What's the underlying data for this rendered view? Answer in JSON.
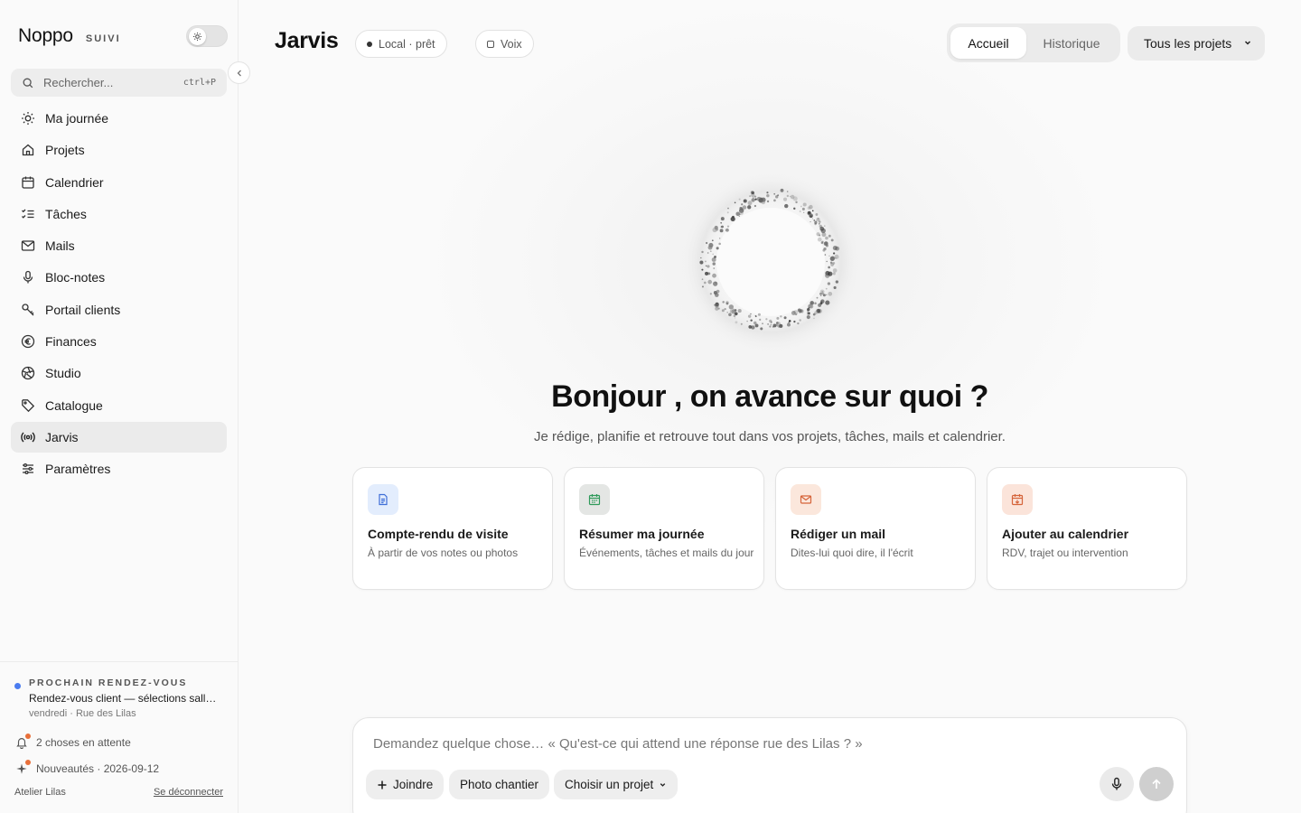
{
  "sidebar": {
    "brand": "Noppo",
    "brand_tag": "SUIVI",
    "theme_icon": "sun-icon",
    "search": {
      "placeholder": "Rechercher...",
      "shortcut": "ctrl+P"
    },
    "items": [
      {
        "label": "Ma journée",
        "icon": "sun-icon",
        "active": false
      },
      {
        "label": "Projets",
        "icon": "home-icon",
        "active": false
      },
      {
        "label": "Calendrier",
        "icon": "calendar-icon",
        "active": false
      },
      {
        "label": "Tâches",
        "icon": "checklist-icon",
        "active": false
      },
      {
        "label": "Mails",
        "icon": "mail-icon",
        "active": false
      },
      {
        "label": "Bloc-notes",
        "icon": "microphone-icon",
        "active": false
      },
      {
        "label": "Portail clients",
        "icon": "key-icon",
        "active": false
      },
      {
        "label": "Finances",
        "icon": "euro-icon",
        "active": false
      },
      {
        "label": "Studio",
        "icon": "aperture-icon",
        "active": false
      },
      {
        "label": "Catalogue",
        "icon": "tag-icon",
        "active": false
      },
      {
        "label": "Jarvis",
        "icon": "broadcast-icon",
        "active": true
      },
      {
        "label": "Paramètres",
        "icon": "sliders-icon",
        "active": false
      }
    ],
    "footer": {
      "next_label": "PROCHAIN RENDEZ-VOUS",
      "next_title": "Rendez-vous client — sélections sall…",
      "next_sub": "vendredi · Rue des Lilas",
      "pending": "2 choses en attente",
      "news": "Nouveautés · 2026-09-12",
      "workspace": "Atelier Lilas",
      "logout": "Se déconnecter",
      "accent": "#4a7cf0",
      "badge_color": "#e8703a"
    }
  },
  "header": {
    "title": "Jarvis",
    "status_pill": "Local · prêt",
    "voice_pill": "Voix",
    "tabs": [
      {
        "label": "Accueil",
        "active": true
      },
      {
        "label": "Historique",
        "active": false
      }
    ],
    "project_select": "Tous les projets"
  },
  "hero": {
    "headline": "Bonjour , on avance sur quoi ?",
    "subline": "Je rédige, planifie et retrouve tout dans vos projets, tâches, mails et calendrier."
  },
  "cards": [
    {
      "title": "Compte-rendu de visite",
      "sub": "À partir de vos notes ou photos",
      "icon": "document-icon",
      "bg": "#e3edfd",
      "fg": "#3f6fd8"
    },
    {
      "title": "Résumer ma journée",
      "sub": "Événements, tâches et mails du jour",
      "icon": "calendar-icon",
      "bg": "#e4e6e4",
      "fg": "#2f9a5a"
    },
    {
      "title": "Rédiger un mail",
      "sub": "Dites-lui quoi dire, il l'écrit",
      "icon": "mail-icon",
      "bg": "#fbe7dc",
      "fg": "#d5643a"
    },
    {
      "title": "Ajouter au calendrier",
      "sub": "RDV, trajet ou intervention",
      "icon": "calendar-plus-icon",
      "bg": "#fbe4da",
      "fg": "#d5643a"
    }
  ],
  "composer": {
    "placeholder": "Demandez quelque chose… « Qu'est-ce qui attend une réponse rue des Lilas ? »",
    "attach": "Joindre",
    "photo": "Photo chantier",
    "project": "Choisir un projet"
  }
}
